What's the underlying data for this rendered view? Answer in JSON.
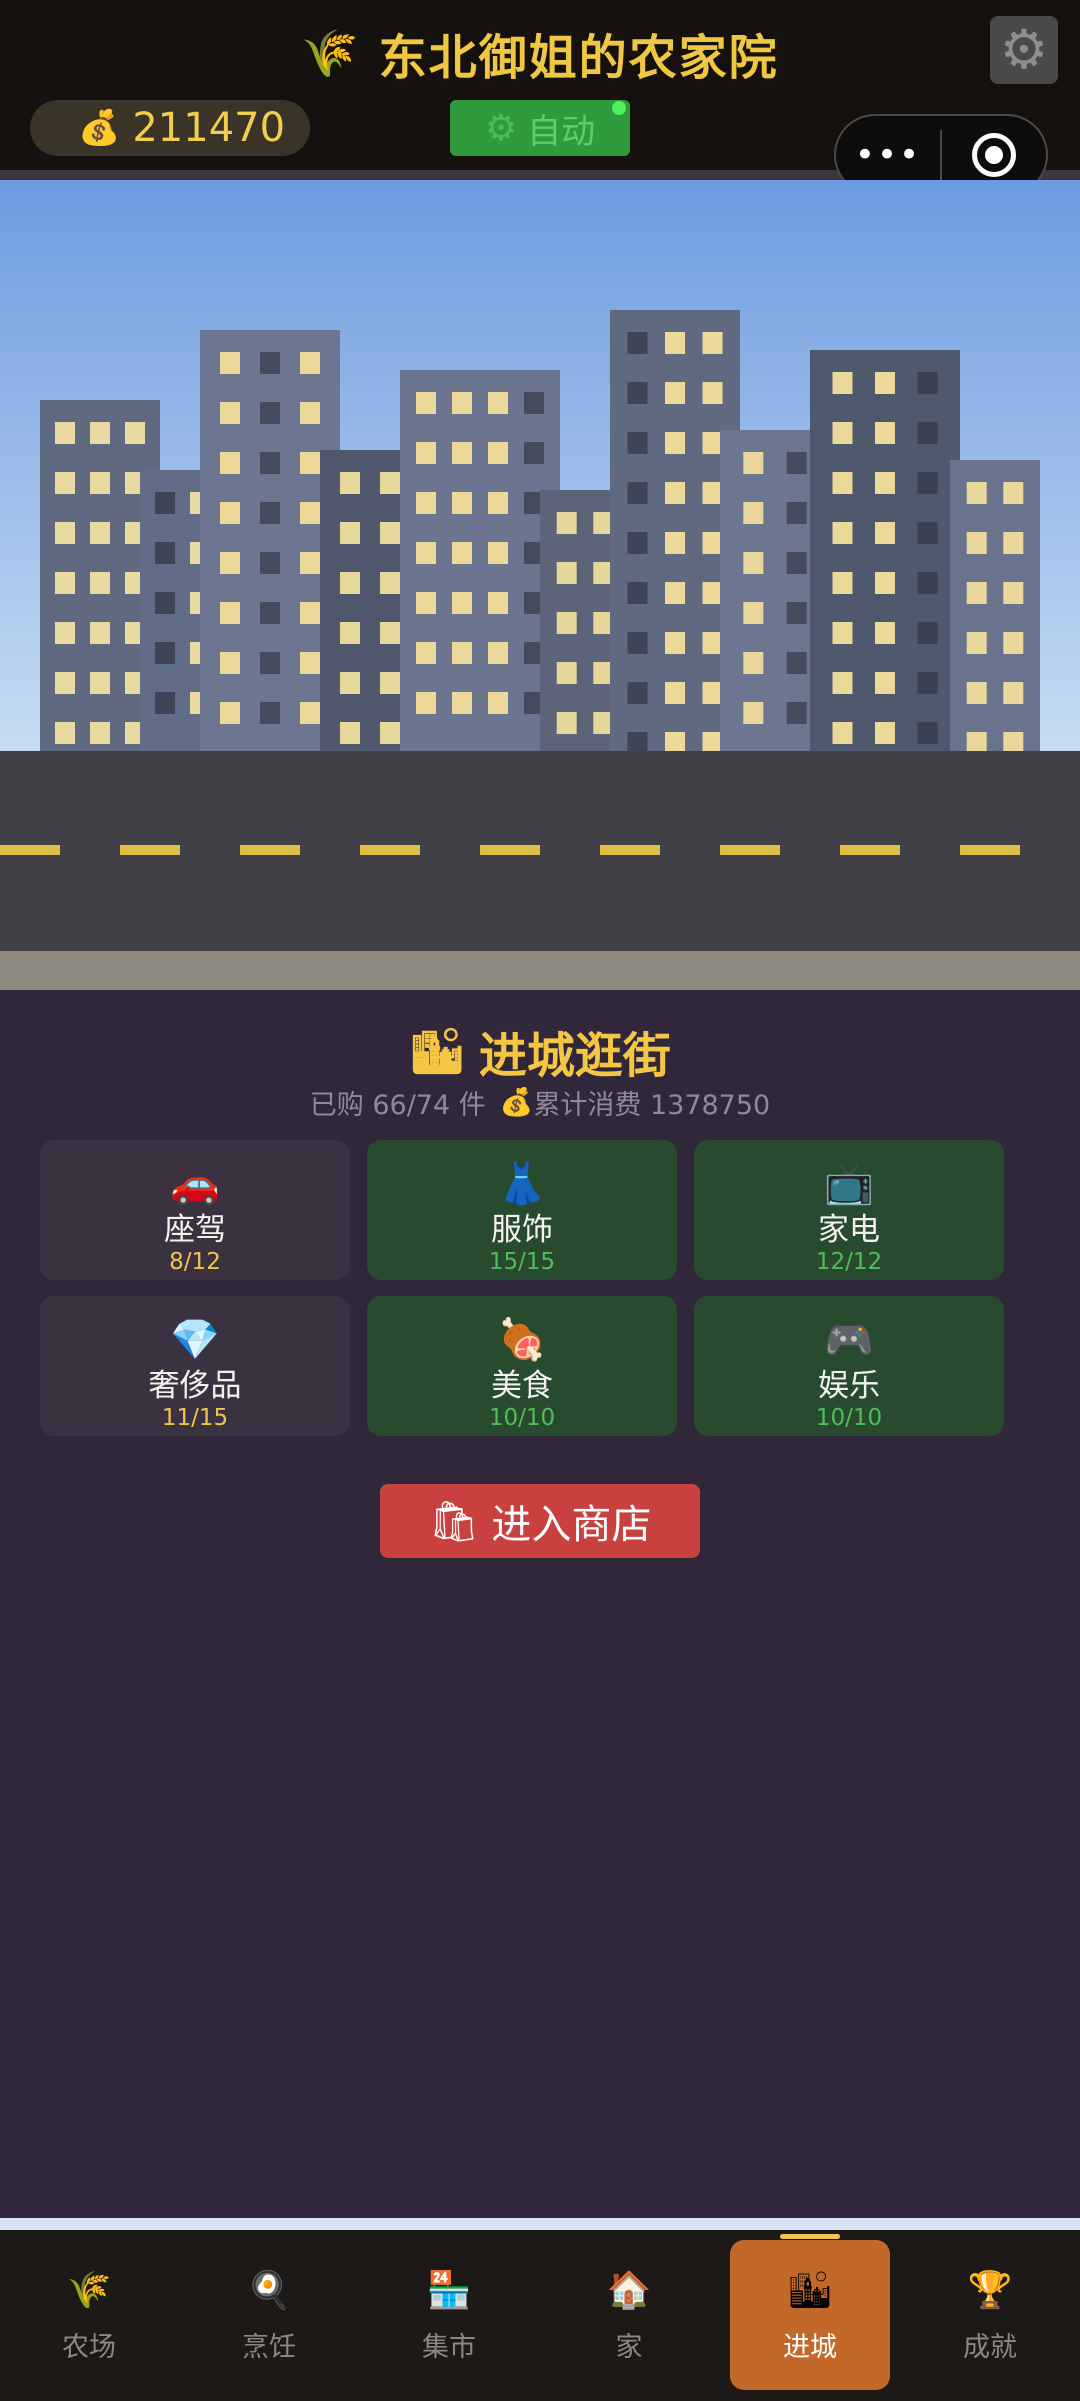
{
  "header": {
    "title_emoji": "🌾",
    "title": "东北御姐的农家院",
    "settings_icon": "⚙",
    "coins_emoji": "💰",
    "coins": "211470",
    "auto_icon": "⚙",
    "auto_label": "自动",
    "capsule_more": "•••"
  },
  "shop": {
    "title_emoji": "🏙",
    "title": "进城逛街",
    "purchased": "已购 66/74 件",
    "spent_emoji": "💰",
    "spent": "累计消费 1378750",
    "categories": [
      {
        "icon": "🚗",
        "name": "座驾",
        "count": "8/12",
        "complete": false
      },
      {
        "icon": "👗",
        "name": "服饰",
        "count": "15/15",
        "complete": true
      },
      {
        "icon": "📺",
        "name": "家电",
        "count": "12/12",
        "complete": true
      },
      {
        "icon": "💎",
        "name": "奢侈品",
        "count": "11/15",
        "complete": false
      },
      {
        "icon": "🍖",
        "name": "美食",
        "count": "10/10",
        "complete": true
      },
      {
        "icon": "🎮",
        "name": "娱乐",
        "count": "10/10",
        "complete": true
      }
    ],
    "enter_emoji": "🛍",
    "enter_label": "进入商店"
  },
  "nav": {
    "items": [
      {
        "icon": "🌾",
        "label": "农场"
      },
      {
        "icon": "🍳",
        "label": "烹饪"
      },
      {
        "icon": "🏪",
        "label": "集市"
      },
      {
        "icon": "🏠",
        "label": "家"
      },
      {
        "icon": "🏙",
        "label": "进城",
        "active": true
      },
      {
        "icon": "🏆",
        "label": "成就"
      }
    ]
  },
  "colors": {
    "accent_gold": "#f0c742",
    "complete_green": "#4fbe5a",
    "active_tab": "#c2692a",
    "enter_button": "#c8413e"
  }
}
